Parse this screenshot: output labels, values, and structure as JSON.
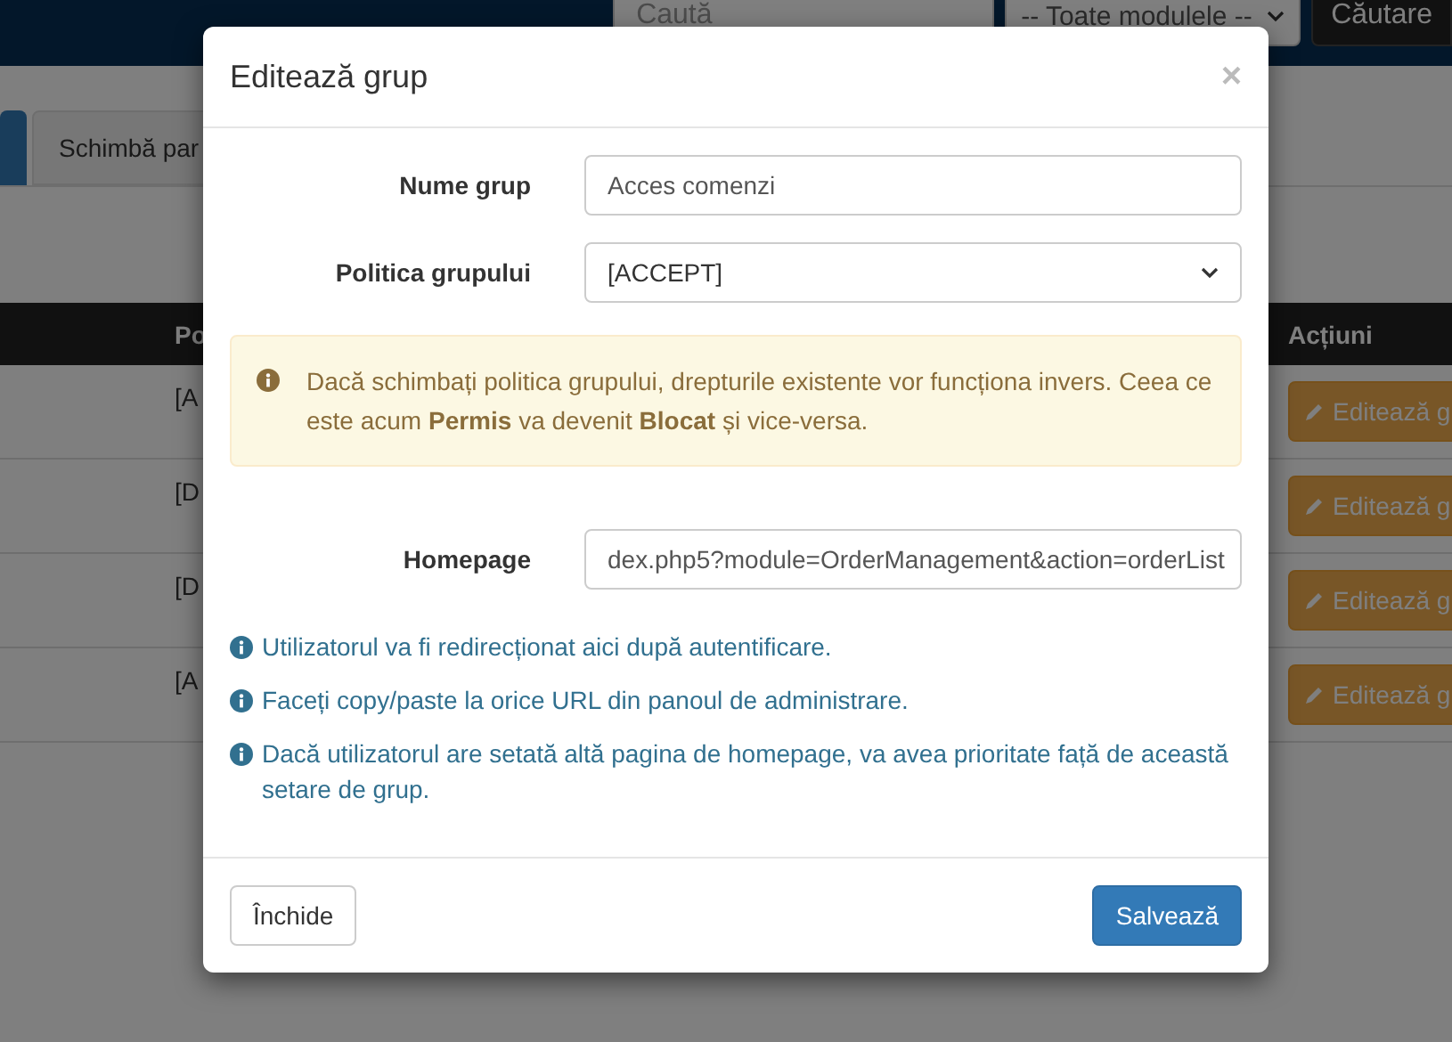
{
  "navbar": {
    "search": {
      "placeholder": "Caută"
    },
    "module_select": {
      "value": "-- Toate modulele --"
    },
    "search_button": "Căutare"
  },
  "tabs": [
    {
      "selected": true
    },
    {
      "label": "Schimbă par",
      "selected": false
    }
  ],
  "table": {
    "columns": [
      "Po",
      "Acțiuni"
    ],
    "rows": [
      {
        "policy": "[A",
        "action": "Editează g"
      },
      {
        "policy": "[D",
        "action": "Editează g"
      },
      {
        "policy": "[D",
        "action": "Editează g"
      },
      {
        "policy": "[A",
        "action": "Editează g"
      }
    ]
  },
  "modal": {
    "title": "Editează grup",
    "close": "×",
    "fields": [
      {
        "kind": "input",
        "label": "Nume grup",
        "value": "Acces comenzi"
      },
      {
        "kind": "select",
        "label": "Politica grupului",
        "value": "[ACCEPT]"
      }
    ],
    "alert": "Dacă schimbați politica grupului, drepturile existente vor funcționa invers. Ceea ce este acum **Permis** va devenit **Blocat** și vice-versa.",
    "homepage": {
      "label": "Homepage",
      "value": "dex.php5?module=OrderManagement&action=orderList"
    },
    "help": [
      "Utilizatorul va fi redirecționat aici după autentificare.",
      "Faceți copy/paste la orice URL din panoul de administrare.",
      "Dacă utilizatorul are setată altă pagina de homepage, va avea prioritate față de această setare de grup."
    ],
    "buttons": {
      "close": "Închide",
      "save": "Salvează"
    }
  }
}
